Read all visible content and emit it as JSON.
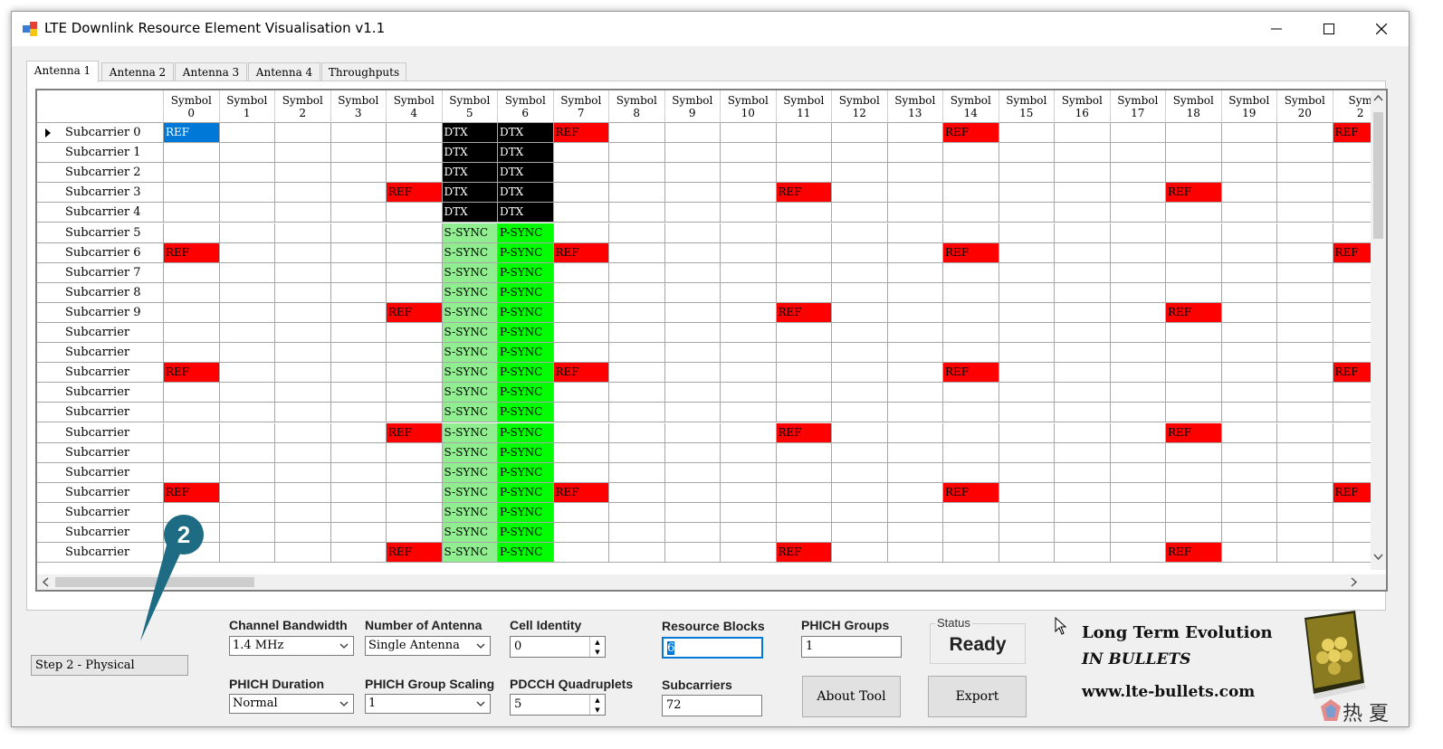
{
  "window": {
    "title": "LTE Downlink Resource Element Visualisation v1.1"
  },
  "tabs": [
    "Antenna 1",
    "Antenna 2",
    "Antenna 3",
    "Antenna 4",
    "Throughputs"
  ],
  "grid": {
    "columns": [
      {
        "top": "Symbol",
        "num": "0"
      },
      {
        "top": "Symbol",
        "num": "1"
      },
      {
        "top": "Symbol",
        "num": "2"
      },
      {
        "top": "Symbol",
        "num": "3"
      },
      {
        "top": "Symbol",
        "num": "4"
      },
      {
        "top": "Symbol",
        "num": "5"
      },
      {
        "top": "Symbol",
        "num": "6"
      },
      {
        "top": "Symbol",
        "num": "7"
      },
      {
        "top": "Symbol",
        "num": "8"
      },
      {
        "top": "Symbol",
        "num": "9"
      },
      {
        "top": "Symbol",
        "num": "10"
      },
      {
        "top": "Symbol",
        "num": "11"
      },
      {
        "top": "Symbol",
        "num": "12"
      },
      {
        "top": "Symbol",
        "num": "13"
      },
      {
        "top": "Symbol",
        "num": "14"
      },
      {
        "top": "Symbol",
        "num": "15"
      },
      {
        "top": "Symbol",
        "num": "16"
      },
      {
        "top": "Symbol",
        "num": "17"
      },
      {
        "top": "Symbol",
        "num": "18"
      },
      {
        "top": "Symbol",
        "num": "19"
      },
      {
        "top": "Symbol",
        "num": "20"
      },
      {
        "top": "Sym",
        "num": "2"
      }
    ],
    "rows": [
      "Subcarrier 0",
      "Subcarrier 1",
      "Subcarrier 2",
      "Subcarrier 3",
      "Subcarrier 4",
      "Subcarrier 5",
      "Subcarrier 6",
      "Subcarrier 7",
      "Subcarrier 8",
      "Subcarrier 9",
      "Subcarrier",
      "Subcarrier",
      "Subcarrier",
      "Subcarrier",
      "Subcarrier",
      "Subcarrier",
      "Subcarrier",
      "Subcarrier",
      "Subcarrier",
      "Subcarrier",
      "Subcarrier",
      "Subcarrier"
    ],
    "cells": [
      [
        "REF*",
        "",
        "",
        "",
        "",
        "DTX",
        "DTX",
        "REF",
        "",
        "",
        "",
        "",
        "",
        "",
        "REF",
        "",
        "",
        "",
        "",
        "",
        "",
        "REF"
      ],
      [
        "",
        "",
        "",
        "",
        "",
        "DTX",
        "DTX",
        "",
        "",
        "",
        "",
        "",
        "",
        "",
        "",
        "",
        "",
        "",
        "",
        "",
        "",
        ""
      ],
      [
        "",
        "",
        "",
        "",
        "",
        "DTX",
        "DTX",
        "",
        "",
        "",
        "",
        "",
        "",
        "",
        "",
        "",
        "",
        "",
        "",
        "",
        "",
        ""
      ],
      [
        "",
        "",
        "",
        "",
        "REF",
        "DTX",
        "DTX",
        "",
        "",
        "",
        "",
        "REF",
        "",
        "",
        "",
        "",
        "",
        "",
        "REF",
        "",
        "",
        ""
      ],
      [
        "",
        "",
        "",
        "",
        "",
        "DTX",
        "DTX",
        "",
        "",
        "",
        "",
        "",
        "",
        "",
        "",
        "",
        "",
        "",
        "",
        "",
        "",
        ""
      ],
      [
        "",
        "",
        "",
        "",
        "",
        "S-SYNC",
        "P-SYNC",
        "",
        "",
        "",
        "",
        "",
        "",
        "",
        "",
        "",
        "",
        "",
        "",
        "",
        "",
        ""
      ],
      [
        "REF",
        "",
        "",
        "",
        "",
        "S-SYNC",
        "P-SYNC",
        "REF",
        "",
        "",
        "",
        "",
        "",
        "",
        "REF",
        "",
        "",
        "",
        "",
        "",
        "",
        "REF"
      ],
      [
        "",
        "",
        "",
        "",
        "",
        "S-SYNC",
        "P-SYNC",
        "",
        "",
        "",
        "",
        "",
        "",
        "",
        "",
        "",
        "",
        "",
        "",
        "",
        "",
        ""
      ],
      [
        "",
        "",
        "",
        "",
        "",
        "S-SYNC",
        "P-SYNC",
        "",
        "",
        "",
        "",
        "",
        "",
        "",
        "",
        "",
        "",
        "",
        "",
        "",
        "",
        ""
      ],
      [
        "",
        "",
        "",
        "",
        "REF",
        "S-SYNC",
        "P-SYNC",
        "",
        "",
        "",
        "",
        "REF",
        "",
        "",
        "",
        "",
        "",
        "",
        "REF",
        "",
        "",
        ""
      ],
      [
        "",
        "",
        "",
        "",
        "",
        "S-SYNC",
        "P-SYNC",
        "",
        "",
        "",
        "",
        "",
        "",
        "",
        "",
        "",
        "",
        "",
        "",
        "",
        "",
        ""
      ],
      [
        "",
        "",
        "",
        "",
        "",
        "S-SYNC",
        "P-SYNC",
        "",
        "",
        "",
        "",
        "",
        "",
        "",
        "",
        "",
        "",
        "",
        "",
        "",
        "",
        ""
      ],
      [
        "REF",
        "",
        "",
        "",
        "",
        "S-SYNC",
        "P-SYNC",
        "REF",
        "",
        "",
        "",
        "",
        "",
        "",
        "REF",
        "",
        "",
        "",
        "",
        "",
        "",
        "REF"
      ],
      [
        "",
        "",
        "",
        "",
        "",
        "S-SYNC",
        "P-SYNC",
        "",
        "",
        "",
        "",
        "",
        "",
        "",
        "",
        "",
        "",
        "",
        "",
        "",
        "",
        ""
      ],
      [
        "",
        "",
        "",
        "",
        "",
        "S-SYNC",
        "P-SYNC",
        "",
        "",
        "",
        "",
        "",
        "",
        "",
        "",
        "",
        "",
        "",
        "",
        "",
        "",
        ""
      ],
      [
        "",
        "",
        "",
        "",
        "REF",
        "S-SYNC",
        "P-SYNC",
        "",
        "",
        "",
        "",
        "REF",
        "",
        "",
        "",
        "",
        "",
        "",
        "REF",
        "",
        "",
        ""
      ],
      [
        "",
        "",
        "",
        "",
        "",
        "S-SYNC",
        "P-SYNC",
        "",
        "",
        "",
        "",
        "",
        "",
        "",
        "",
        "",
        "",
        "",
        "",
        "",
        "",
        ""
      ],
      [
        "",
        "",
        "",
        "",
        "",
        "S-SYNC",
        "P-SYNC",
        "",
        "",
        "",
        "",
        "",
        "",
        "",
        "",
        "",
        "",
        "",
        "",
        "",
        "",
        ""
      ],
      [
        "REF",
        "",
        "",
        "",
        "",
        "S-SYNC",
        "P-SYNC",
        "REF",
        "",
        "",
        "",
        "",
        "",
        "",
        "REF",
        "",
        "",
        "",
        "",
        "",
        "",
        "REF"
      ],
      [
        "",
        "",
        "",
        "",
        "",
        "S-SYNC",
        "P-SYNC",
        "",
        "",
        "",
        "",
        "",
        "",
        "",
        "",
        "",
        "",
        "",
        "",
        "",
        "",
        ""
      ],
      [
        "",
        "",
        "",
        "",
        "",
        "S-SYNC",
        "P-SYNC",
        "",
        "",
        "",
        "",
        "",
        "",
        "",
        "",
        "",
        "",
        "",
        "",
        "",
        "",
        ""
      ],
      [
        "",
        "",
        "",
        "",
        "REF",
        "S-SYNC",
        "P-SYNC",
        "",
        "",
        "",
        "",
        "REF",
        "",
        "",
        "",
        "",
        "",
        "",
        "REF",
        "",
        "",
        ""
      ]
    ],
    "colors": {
      "REF": "#ff0000",
      "REF*": "#0078d7",
      "DTX": "#000000",
      "S-SYNC": "#90ee90",
      "P-SYNC": "#00ff00"
    }
  },
  "step": {
    "label": "Step 2 - Physical",
    "badge": "2"
  },
  "controls": {
    "channel_bandwidth": {
      "label": "Channel Bandwidth",
      "value": "1.4 MHz"
    },
    "number_of_antenna": {
      "label": "Number of Antenna",
      "value": "Single Antenna"
    },
    "cell_identity": {
      "label": "Cell Identity",
      "value": "0"
    },
    "resource_blocks": {
      "label": "Resource Blocks",
      "value": "6"
    },
    "phich_groups": {
      "label": "PHICH Groups",
      "value": "1"
    },
    "phich_duration": {
      "label": "PHICH Duration",
      "value": "Normal"
    },
    "phich_group_scaling": {
      "label": "PHICH Group Scaling",
      "value": "1"
    },
    "pdcch_quadruplets": {
      "label": "PDCCH Quadruplets",
      "value": "5"
    },
    "subcarriers": {
      "label": "Subcarriers",
      "value": "72"
    }
  },
  "status": {
    "label": "Status",
    "value": "Ready"
  },
  "buttons": {
    "about": "About Tool",
    "export": "Export"
  },
  "branding": {
    "line1": "Long Term Evolution",
    "line2": "IN BULLETS",
    "url": "www.lte-bullets.com"
  },
  "watermark": "热 夏"
}
